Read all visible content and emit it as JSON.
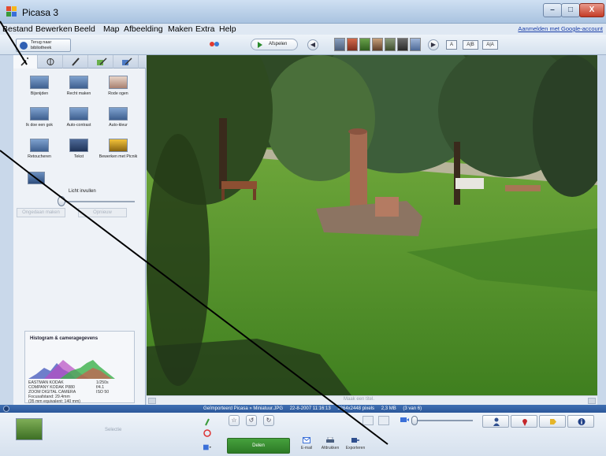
{
  "window": {
    "title": "Picasa 3",
    "controls": {
      "minimize": "–",
      "maximize": "□",
      "close": "X"
    }
  },
  "menu": {
    "items": [
      "Bestand",
      "Bewerken",
      "Beeld",
      "Map",
      "Afbeelding",
      "Maken",
      "Extra",
      "Help"
    ],
    "signin": "Aanmelden met Google-account"
  },
  "toolbar": {
    "back_label": "Terug naar bibliotheek",
    "slideshow_label": "Afspelen",
    "prev_icon": "◀",
    "next_icon": "▶",
    "layout_single": "A",
    "layout_ab": "A|B",
    "layout_aa": "A|A"
  },
  "left_panel": {
    "tabs": [
      "wrench-icon",
      "tuning-icon",
      "brush-icon",
      "effects-icon",
      "more-effects-icon"
    ],
    "tools": [
      {
        "label": "Bijsnijden",
        "icon": "crop-icon"
      },
      {
        "label": "Recht maken",
        "icon": "straighten-icon"
      },
      {
        "label": "Rode ogen",
        "icon": "red-eye-icon"
      },
      {
        "label": "Ik doe een gok",
        "icon": "feeling-lucky-icon"
      },
      {
        "label": "Auto-contrast",
        "icon": "auto-contrast-icon"
      },
      {
        "label": "Auto-kleur",
        "icon": "auto-color-icon"
      },
      {
        "label": "Retoucheren",
        "icon": "retouch-icon"
      },
      {
        "label": "Tekst",
        "icon": "text-icon"
      },
      {
        "label": "Bewerken met Picnik",
        "icon": "picnik-icon"
      }
    ],
    "fill_light_label": "Licht invullen",
    "fill_light_value": 0.0,
    "apply_label": "Ongedaan maken",
    "cancel_label": "Opnieuw",
    "histogram_title": "Histogram & cameragegevens",
    "camera_info_left": [
      "EASTMAN KODAK",
      "COMPANY KODAK P880",
      "ZOOM DIGITAL CAMERA",
      "Focusafstand: 29.4mm",
      "(35 mm equivalent: 140 mm)"
    ],
    "camera_info_right": [
      "1/250s",
      "f/4.1",
      "ISO 50"
    ]
  },
  "photo": {
    "caption_placeholder": "Maak een titel."
  },
  "status": {
    "path": "Geïmporteerd Picasa » Miniatuur.JPG",
    "date": "22-8-2007 11:16:13",
    "resolution": "3264x2448 pixels",
    "size": "2,3 MB",
    "position": "(3 van 6)"
  },
  "tray": {
    "selection_label": "Selectie",
    "upload_label": "Delen",
    "email_label": "E-mail",
    "print_label": "Afdrukken",
    "export_label": "Exporteren",
    "star_icon": "☆",
    "rotate_left_icon": "↺",
    "rotate_right_icon": "↻",
    "zoom_value": 0.0
  },
  "colors": {
    "status_bar": "#2b579a",
    "upload_button": "#2c7a26",
    "grass": "#4d8f2c"
  }
}
